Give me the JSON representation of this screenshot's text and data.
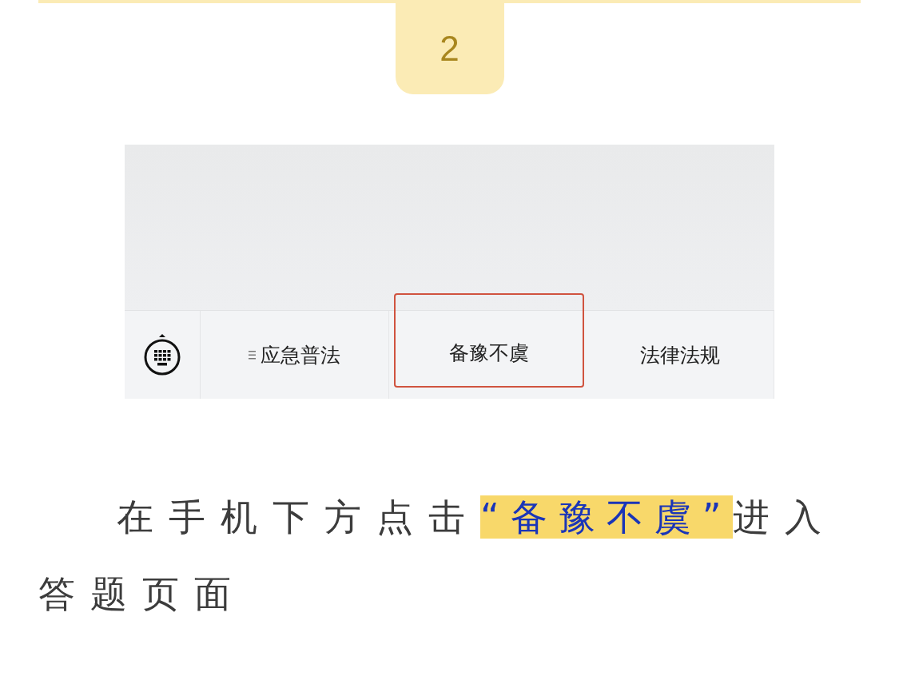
{
  "step_badge": "2",
  "phone_screenshot": {
    "tabs": [
      {
        "label": "应急普法",
        "has_menu_icon": true,
        "highlighted": false
      },
      {
        "label": "备豫不虞",
        "has_menu_icon": false,
        "highlighted": true
      },
      {
        "label": "法律法规",
        "has_menu_icon": false,
        "highlighted": false
      }
    ]
  },
  "instruction": {
    "segments": [
      {
        "text": "在手机下方点击",
        "highlighted": false
      },
      {
        "text": "“备豫不虞”",
        "highlighted": true
      },
      {
        "text": "进入答题页面",
        "highlighted": false
      }
    ]
  }
}
